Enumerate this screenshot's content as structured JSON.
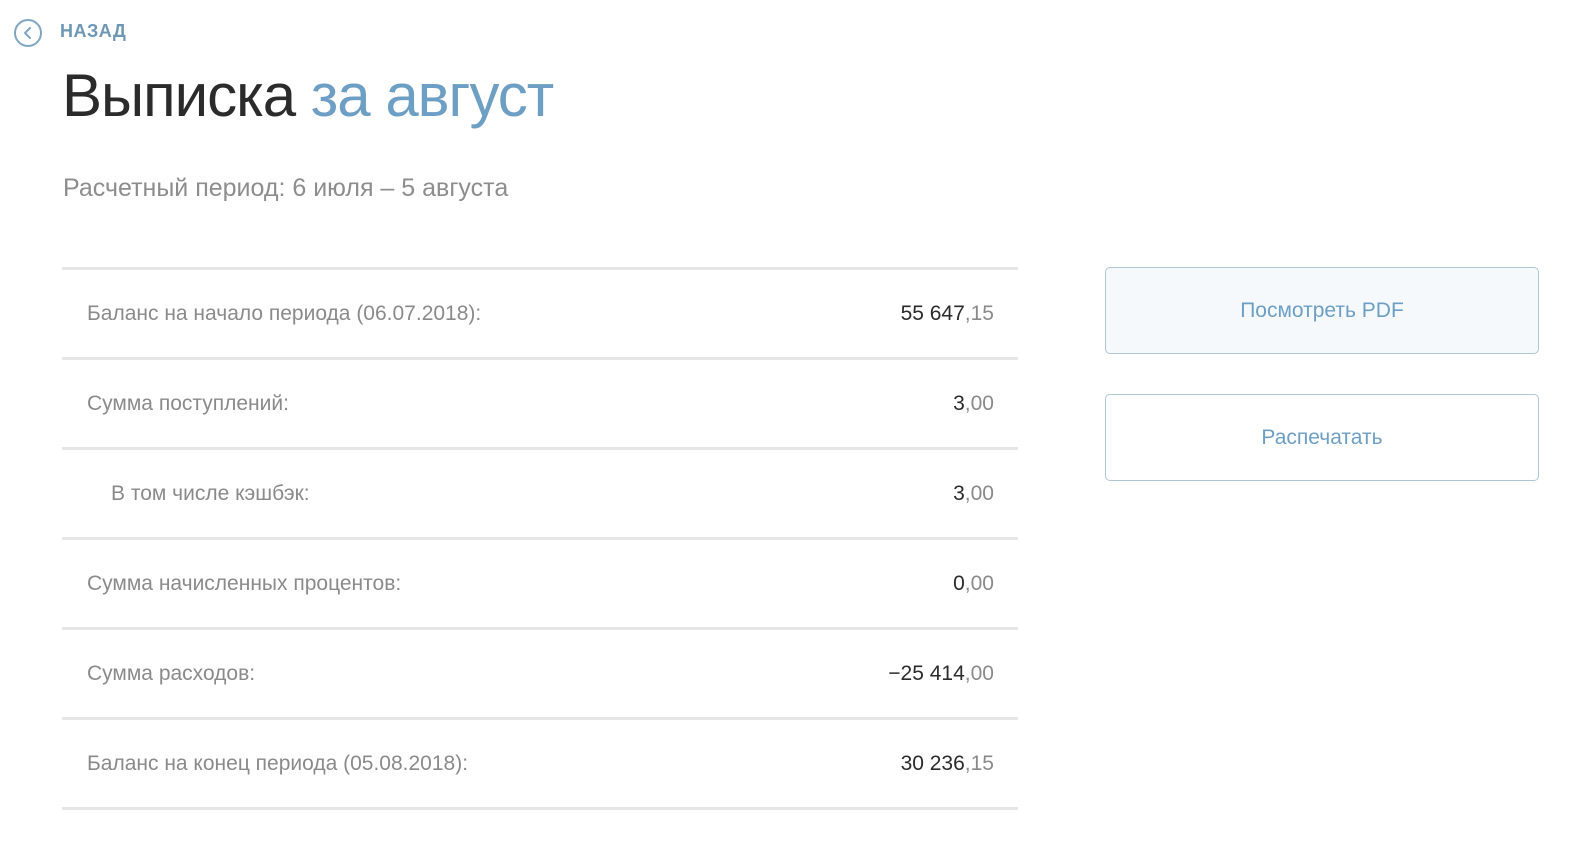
{
  "back": {
    "label": "НАЗАД"
  },
  "title": {
    "main": "Выписка",
    "accent": "за август"
  },
  "period": "Расчетный период: 6 июля – 5 августа",
  "statement": {
    "rows": [
      {
        "label": "Баланс на начало периода (06.07.2018):",
        "int": "55 647",
        "frac": ",15"
      },
      {
        "label": "Сумма поступлений:",
        "int": "3",
        "frac": ",00"
      },
      {
        "label": "В том числе кэшбэк:",
        "int": "3",
        "frac": ",00"
      },
      {
        "label": "Сумма начисленных процентов:",
        "int": "0",
        "frac": ",00"
      },
      {
        "label": "Сумма расходов:",
        "int": "−25 414",
        "frac": ",00"
      },
      {
        "label": "Баланс на конец периода (05.08.2018):",
        "int": "30 236",
        "frac": ",15"
      }
    ]
  },
  "actions": {
    "view_pdf": "Посмотреть PDF",
    "print": "Распечатать"
  },
  "colors": {
    "accent": "#6d9fc4",
    "text_dark": "#2b2b2b",
    "text_muted": "#8a8a8a",
    "divider": "#e6e6e6"
  },
  "icons": {
    "back": "chevron-left-circle-icon"
  }
}
